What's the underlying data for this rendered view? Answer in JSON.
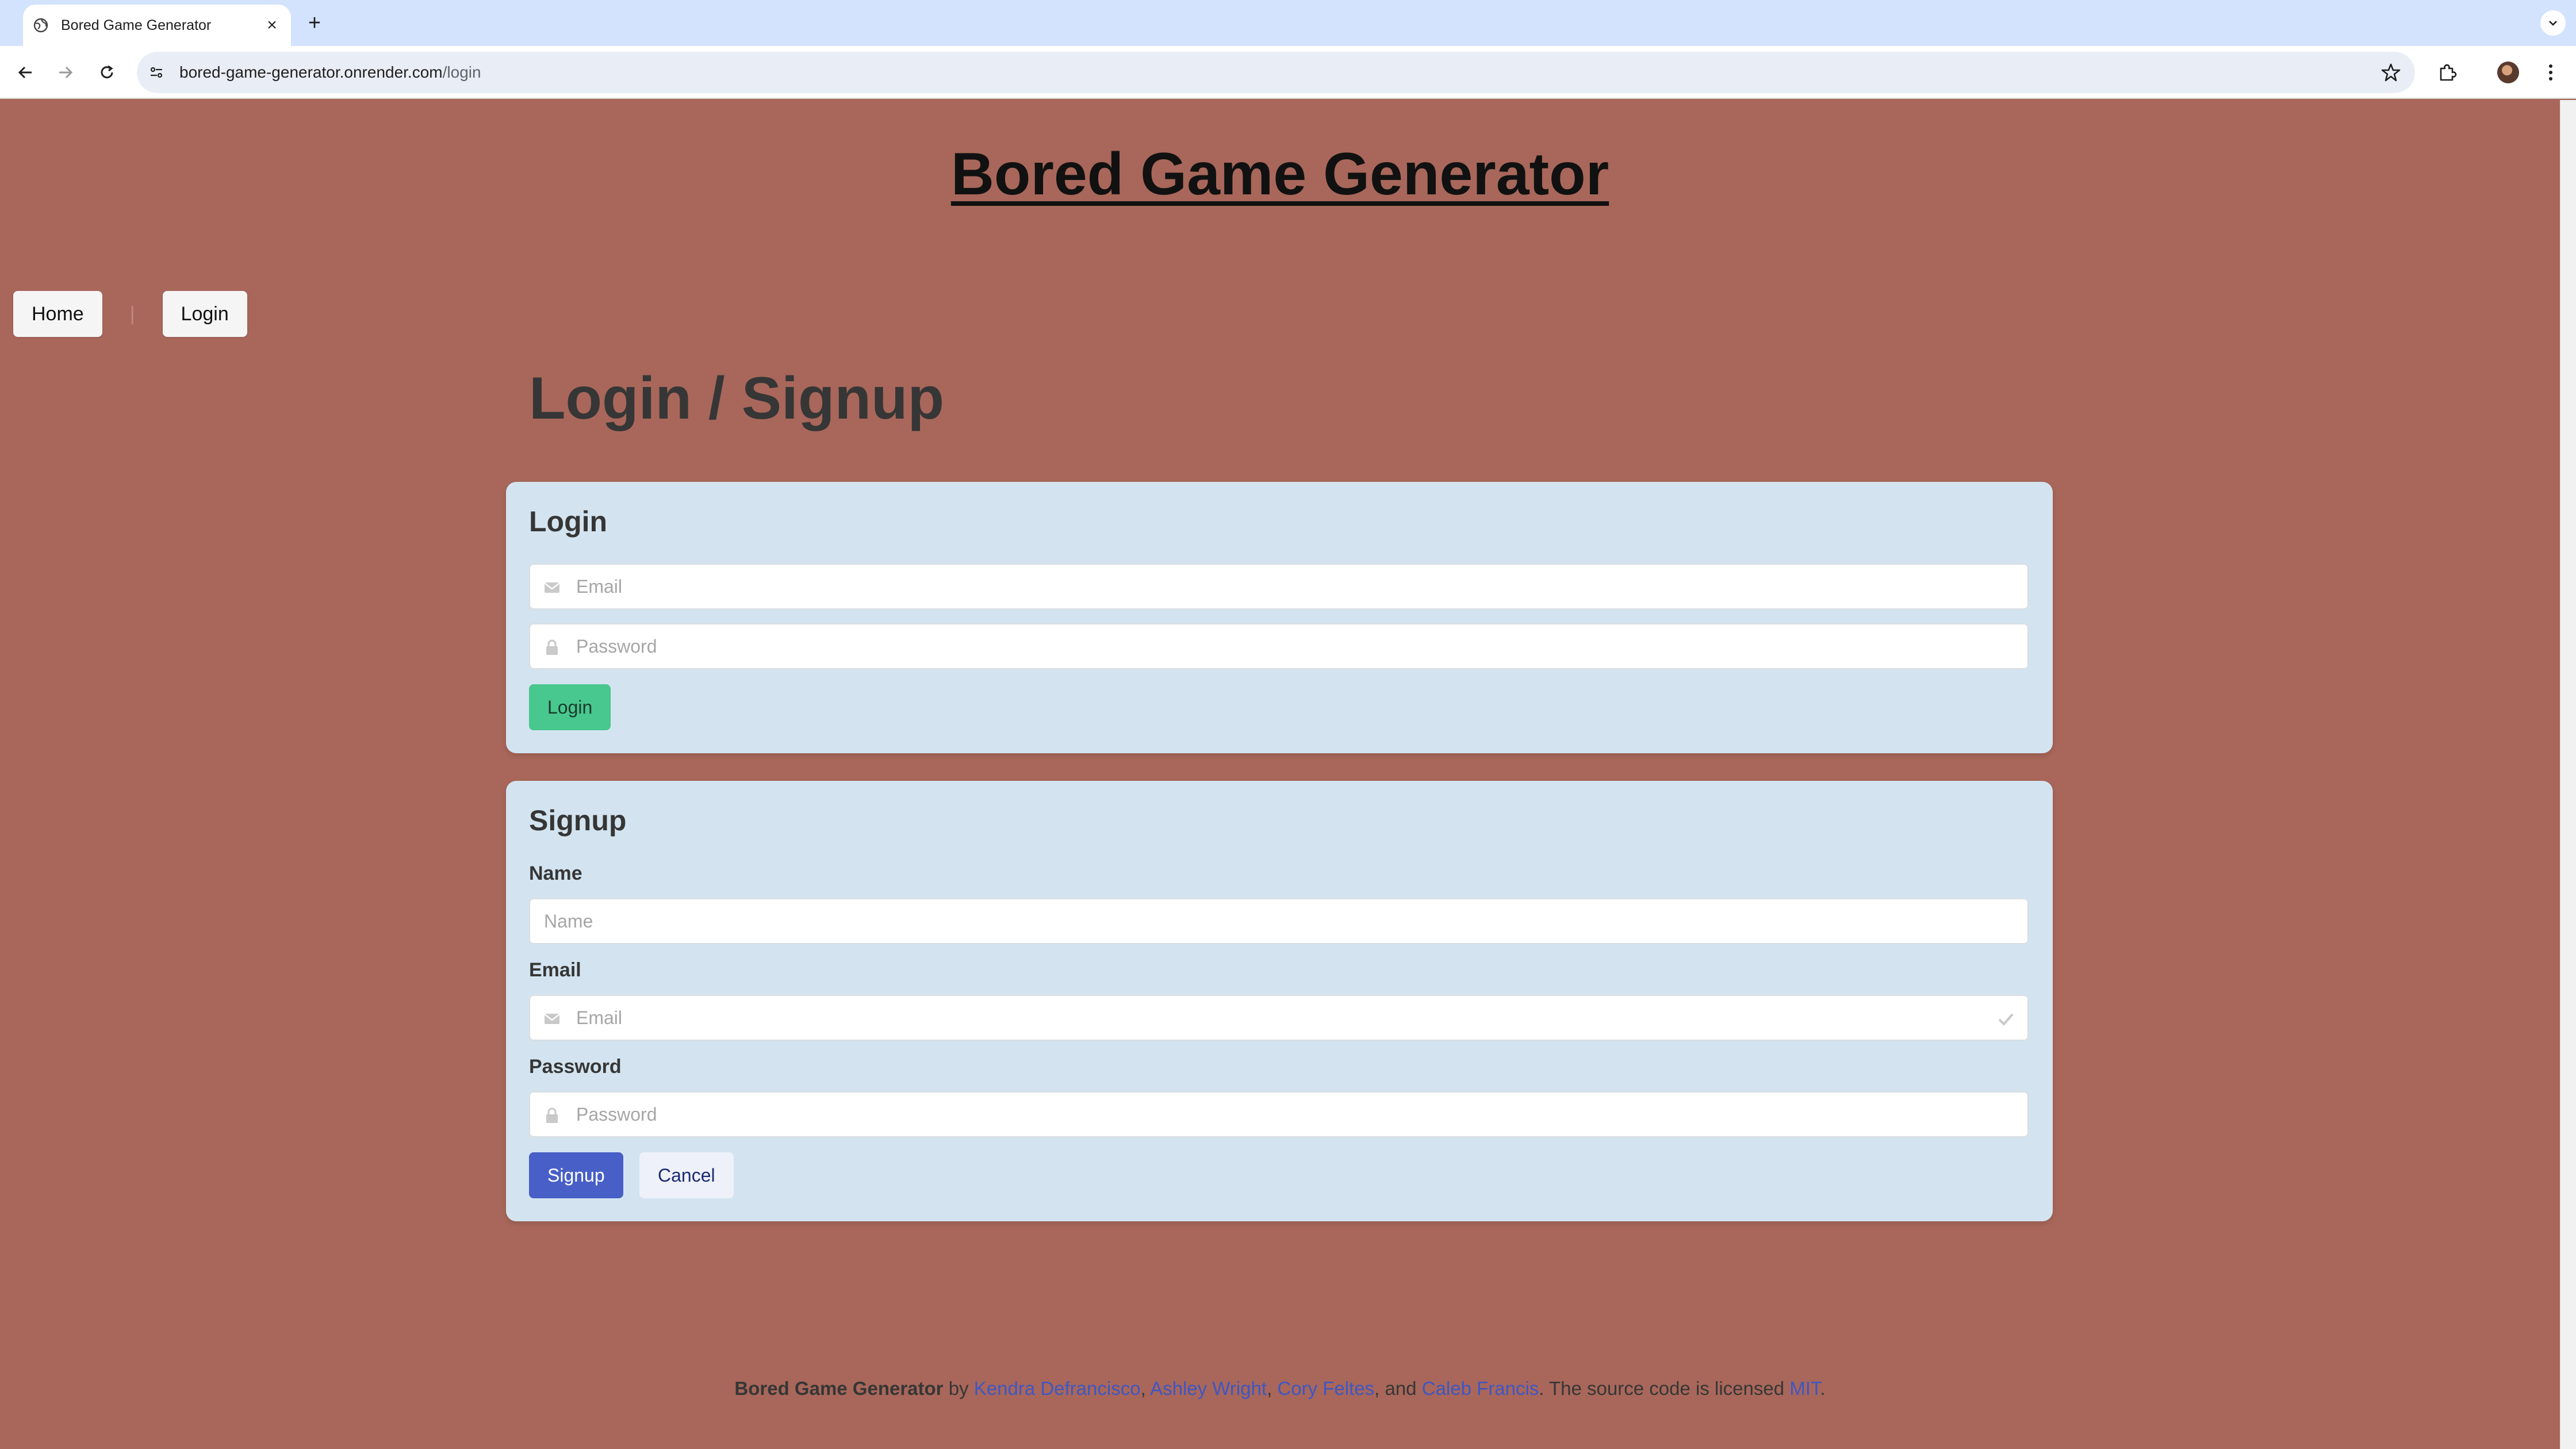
{
  "browser": {
    "tab_title": "Bored Game Generator",
    "tab_close": "×",
    "new_tab": "+",
    "url_domain": "bored-game-generator.onrender.com",
    "url_path": "/login"
  },
  "site": {
    "title": "Bored Game Generator"
  },
  "nav": {
    "home_label": "Home",
    "separator": "|",
    "login_label": "Login"
  },
  "page": {
    "heading": "Login / Signup"
  },
  "login_form": {
    "title": "Login",
    "email_placeholder": "Email",
    "password_placeholder": "Password",
    "submit_label": "Login"
  },
  "signup_form": {
    "title": "Signup",
    "name_label": "Name",
    "name_placeholder": "Name",
    "email_label": "Email",
    "email_placeholder": "Email",
    "password_label": "Password",
    "password_placeholder": "Password",
    "submit_label": "Signup",
    "cancel_label": "Cancel"
  },
  "footer": {
    "site_name": "Bored Game Generator",
    "by": " by ",
    "author1": "Kendra Defrancisco",
    "sep1": ", ",
    "author2": "Ashley Wright",
    "sep2": ", ",
    "author3": "Cory Feltes",
    "sep3": ", and ",
    "author4": "Caleb Francis",
    "license_text": ". The source code is licensed ",
    "license": "MIT",
    "end": "."
  },
  "colors": {
    "page_background": "#a8675a",
    "card_background": "#d3e4f0",
    "login_button": "#48c78e",
    "signup_button": "#485fc7",
    "link": "#3e56c4"
  }
}
